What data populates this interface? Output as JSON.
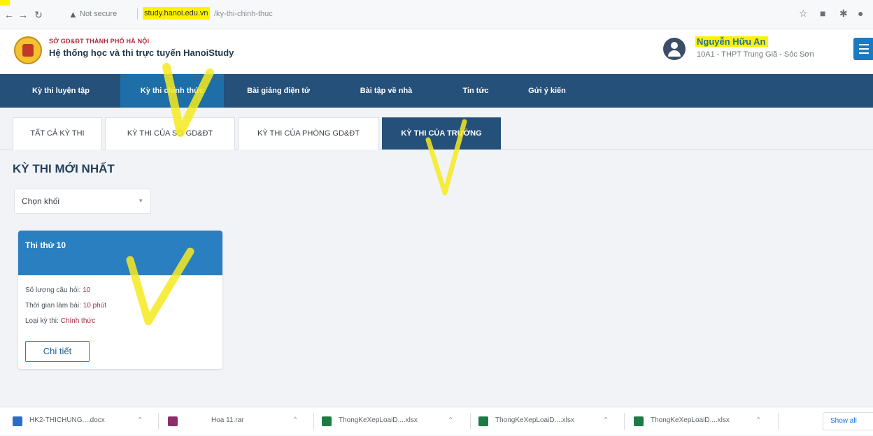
{
  "browser": {
    "not_secure": "Not secure",
    "host": "study.hanoi.edu.vn",
    "path": "/ky-thi-chinh-thuc"
  },
  "header": {
    "org": "SỞ GD&ĐT THÀNH PHỐ HÀ NỘI",
    "system": "Hệ thống học và thi trực tuyến HanoiStudy",
    "user_name": "Nguyễn Hữu An",
    "user_class": "10A1 - THPT Trung Giã - Sóc Sơn"
  },
  "nav": {
    "items": [
      {
        "label": "Kỳ thi luyện tập"
      },
      {
        "label": "Kỳ thi chính thức"
      },
      {
        "label": "Bài giảng điện tử"
      },
      {
        "label": "Bài tập về nhà"
      },
      {
        "label": "Tin tức"
      },
      {
        "label": "Gửi ý kiến"
      }
    ],
    "active_index": 1
  },
  "tabs": {
    "items": [
      {
        "label": "TẤT CẢ KỲ THI"
      },
      {
        "label": "KỲ THI CỦA SỞ GD&ĐT"
      },
      {
        "label": "KỲ THI CỦA PHÒNG GD&ĐT"
      },
      {
        "label": "KỲ THI CỦA TRƯỜNG"
      }
    ],
    "active_index": 3
  },
  "main": {
    "section_title": "KỲ THI MỚI NHẤT",
    "grade_select": "Chọn khối"
  },
  "exam_card": {
    "title": "Thi thử 10",
    "q_label": "Số lượng câu hỏi:",
    "q_value": "10",
    "time_label": "Thời gian làm bài:",
    "time_value": "10 phút",
    "type_label": "Loại kỳ thi:",
    "type_value": "Chính thức",
    "detail_button": "Chi tiết"
  },
  "downloads": {
    "items": [
      {
        "name": "HK2-THICHUNG....docx",
        "icon": "word-file-icon"
      },
      {
        "name": "Hoa 11.rar",
        "icon": "archive-file-icon"
      },
      {
        "name": "ThongKeXepLoaiD....xlsx",
        "icon": "excel-file-icon"
      },
      {
        "name": "ThongKeXepLoaiD....xlsx",
        "icon": "excel-file-icon"
      },
      {
        "name": "ThongKeXepLoaiD....xlsx",
        "icon": "excel-file-icon"
      }
    ],
    "show_all": "Show all"
  },
  "colors": {
    "nav_bg": "#25507a",
    "nav_active": "#1e6ea8",
    "card_head": "#2a7fc0",
    "highlight": "#fff200",
    "value_red": "#b1283f"
  }
}
